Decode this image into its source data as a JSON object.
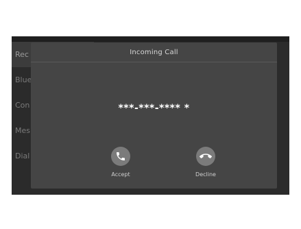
{
  "background_menu": {
    "items": [
      {
        "label": "Rec"
      },
      {
        "label": "Blue"
      },
      {
        "label": "Con"
      },
      {
        "label": "Mes"
      },
      {
        "label": "Dial"
      }
    ]
  },
  "dialog": {
    "title": "Incoming Call",
    "caller": "***-***-**** *",
    "accept_label": "Accept",
    "decline_label": "Decline",
    "accept_icon": "phone-accept-icon",
    "decline_icon": "phone-decline-icon"
  },
  "colors": {
    "screen_bg": "#2b2b2b",
    "dialog_bg": "#454545",
    "button_bg": "#7b7b7b"
  }
}
